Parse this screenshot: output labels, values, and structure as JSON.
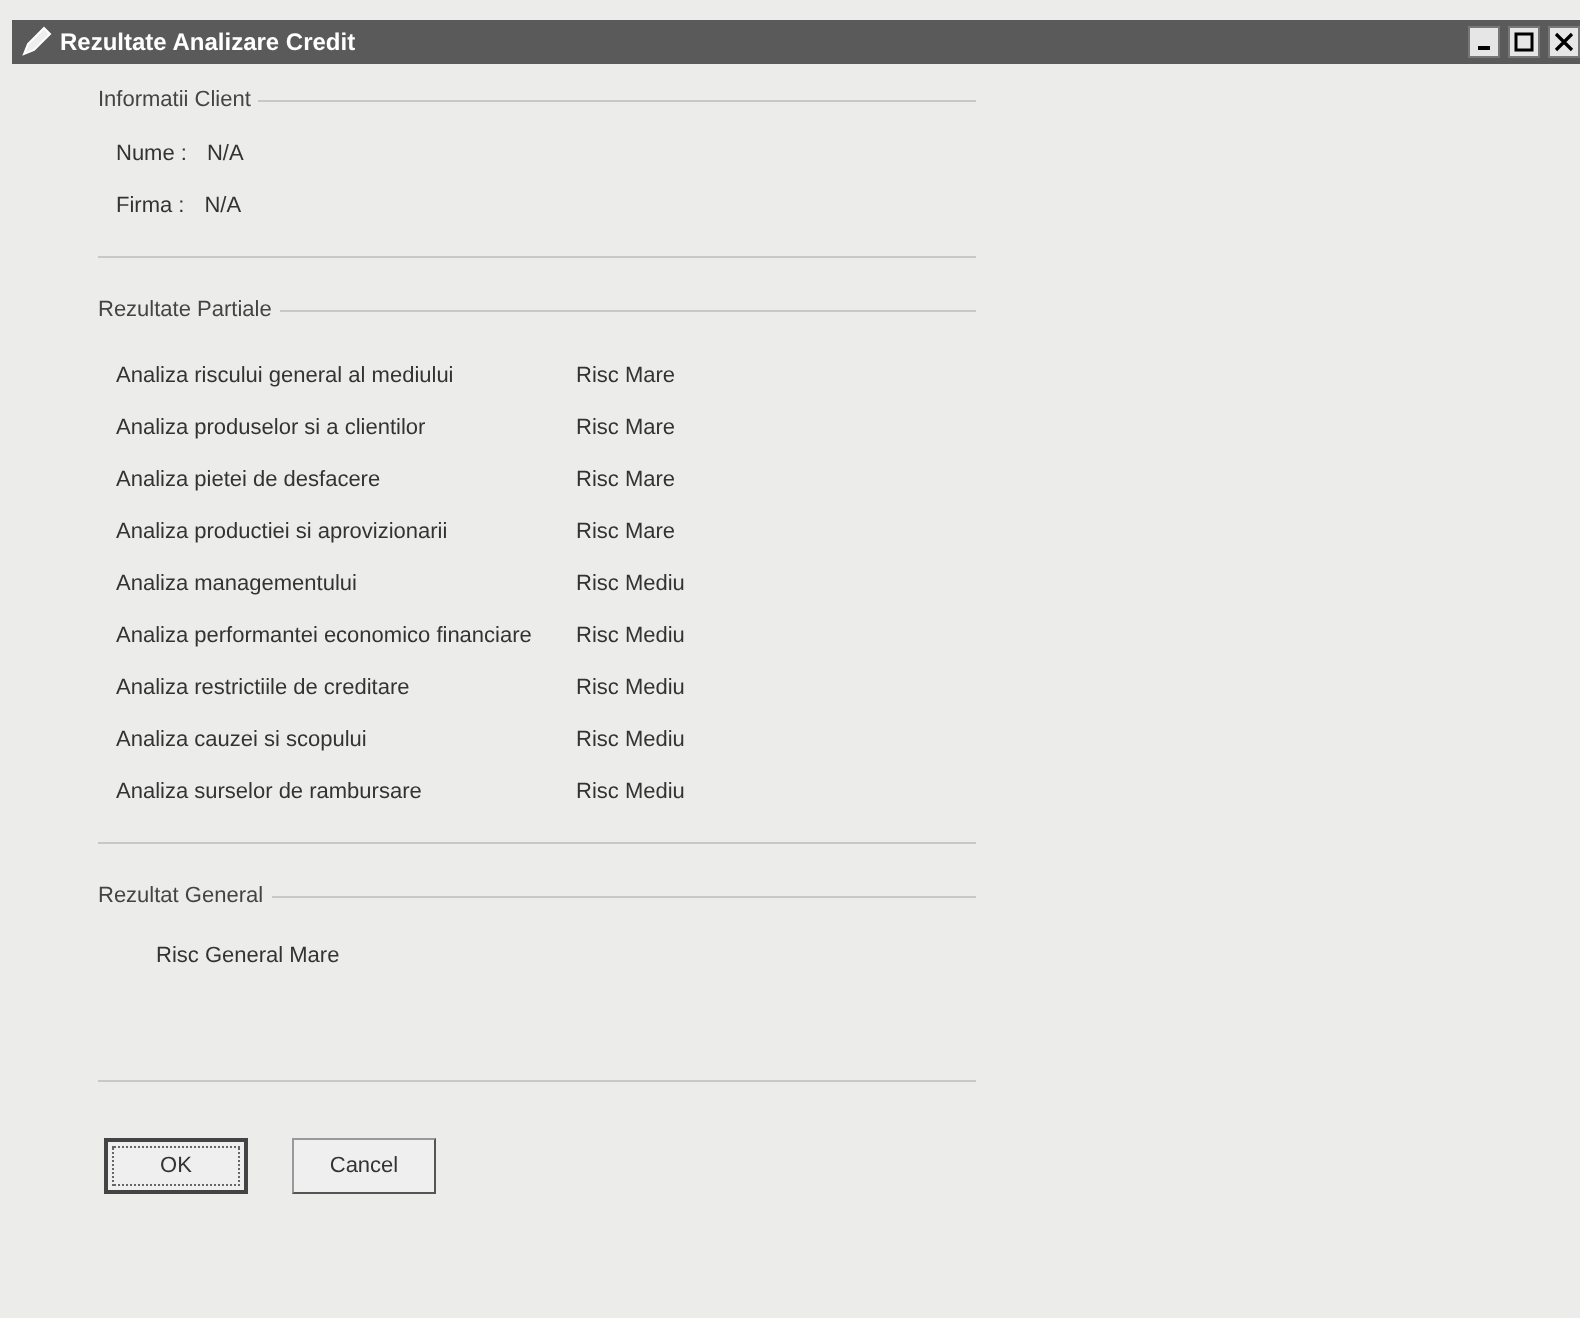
{
  "window": {
    "title": "Rezultate Analizare Credit"
  },
  "client_info": {
    "title": "Informatii Client",
    "fields": [
      {
        "label": "Nume :",
        "value": "N/A"
      },
      {
        "label": "Firma :",
        "value": "N/A"
      }
    ]
  },
  "partial_results": {
    "title": "Rezultate Partiale",
    "rows": [
      {
        "analysis": "Analiza riscului general al mediului",
        "result": "Risc Mare"
      },
      {
        "analysis": "Analiza produselor si a clientilor",
        "result": "Risc Mare"
      },
      {
        "analysis": "Analiza pietei de desfacere",
        "result": "Risc Mare"
      },
      {
        "analysis": "Analiza productiei si aprovizionarii",
        "result": "Risc Mare"
      },
      {
        "analysis": "Analiza managementului",
        "result": "Risc Mediu"
      },
      {
        "analysis": "Analiza performantei economico financiare",
        "result": "Risc Mediu"
      },
      {
        "analysis": "Analiza restrictiile de creditare",
        "result": "Risc Mediu"
      },
      {
        "analysis": "Analiza cauzei si scopului",
        "result": "Risc Mediu"
      },
      {
        "analysis": "Analiza surselor de rambursare",
        "result": "Risc Mediu"
      }
    ]
  },
  "general_result": {
    "title": "Rezultat General",
    "value": "Risc General Mare"
  },
  "buttons": [
    {
      "label": "OK",
      "default": true
    },
    {
      "label": "Cancel",
      "default": false
    }
  ]
}
